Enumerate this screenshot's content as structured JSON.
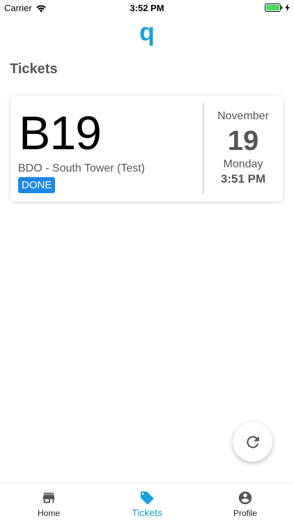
{
  "status_bar": {
    "carrier": "Carrier",
    "time": "3:52 PM",
    "battery_color": "#4cd964"
  },
  "logo": {
    "text": "q",
    "color": "#1ba0d8"
  },
  "page": {
    "title": "Tickets"
  },
  "ticket": {
    "number": "B19",
    "location": "BDO - South Tower (Test)",
    "status": "DONE",
    "status_color": "#1e88e5",
    "month": "November",
    "day": "19",
    "weekday": "Monday",
    "time": "3:51 PM"
  },
  "fab": {
    "icon": "refresh-icon"
  },
  "nav": {
    "active_color": "#1ba0d8",
    "items": [
      {
        "label": "Home",
        "icon": "store-icon"
      },
      {
        "label": "Tickets",
        "icon": "tag-icon"
      },
      {
        "label": "Profile",
        "icon": "account-circle-icon"
      }
    ]
  }
}
